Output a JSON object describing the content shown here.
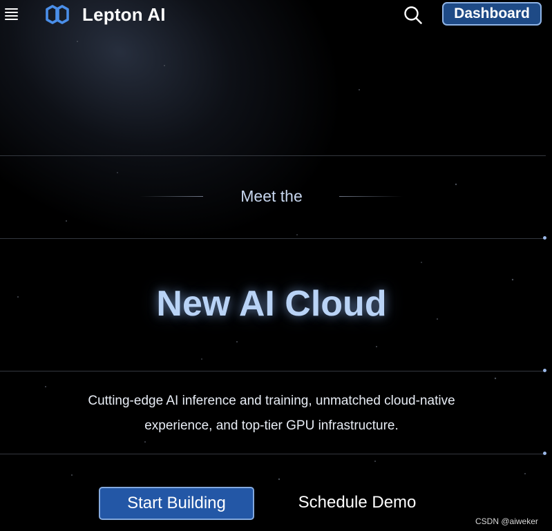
{
  "header": {
    "menu_icon": "hamburger-menu-icon",
    "logo_icon": "lepton-logo-icon",
    "brand": "Lepton AI",
    "search_icon": "search-icon",
    "dashboard_label": "Dashboard"
  },
  "hero": {
    "eyebrow": "Meet the",
    "title": "New AI Cloud",
    "subtitle": "Cutting-edge AI inference and training, unmatched cloud-native experience, and top-tier GPU infrastructure."
  },
  "actions": {
    "primary_label": "Start Building",
    "secondary_label": "Schedule Demo"
  },
  "watermark": "CSDN @aiweker",
  "colors": {
    "background": "#000000",
    "accent": "#2357a6",
    "accent_border": "#84a9de",
    "hero_text": "#b9d3f6",
    "logo": "#4a8ee8"
  }
}
